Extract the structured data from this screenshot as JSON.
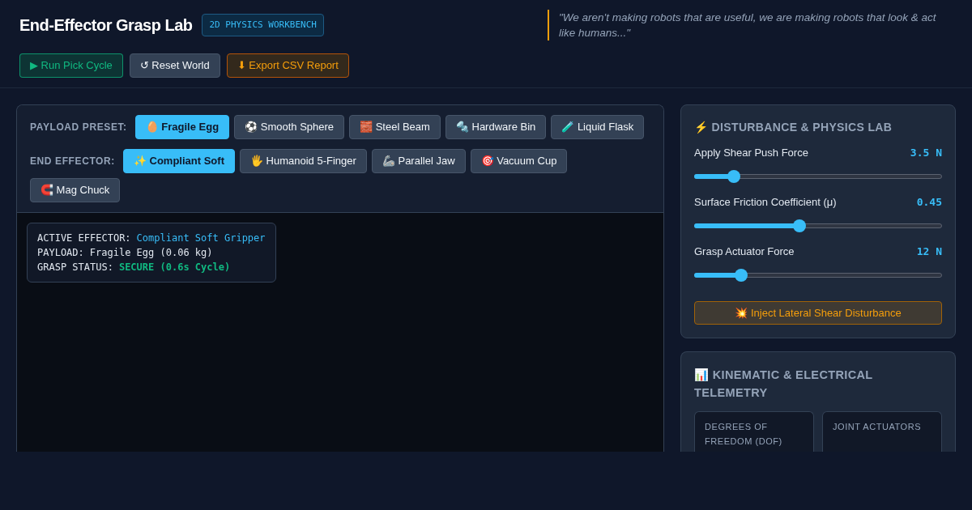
{
  "header": {
    "title": "End-Effector Grasp Lab",
    "badge": "2D PHYSICS WORKBENCH",
    "quote": "\"We aren't making robots that are useful, we are making robots that look & act like humans...\"",
    "actions": [
      {
        "label": "▶ Run Pick Cycle",
        "kind": "success"
      },
      {
        "label": "↺ Reset World",
        "kind": "neutral"
      },
      {
        "label": "⬇ Export CSV Report",
        "kind": "warning"
      }
    ]
  },
  "controls": [
    {
      "label": "PAYLOAD PRESET:",
      "options": [
        {
          "label": "🥚 Fragile Egg",
          "selected": true
        },
        {
          "label": "⚽ Smooth Sphere",
          "selected": false
        },
        {
          "label": "🧱 Steel Beam",
          "selected": false
        },
        {
          "label": "🔩 Hardware Bin",
          "selected": false
        },
        {
          "label": "🧪 Liquid Flask",
          "selected": false
        }
      ]
    },
    {
      "label": "END EFFECTOR:",
      "options": [
        {
          "label": "✨ Compliant Soft",
          "selected": true
        },
        {
          "label": "🖐️ Humanoid 5-Finger",
          "selected": false
        },
        {
          "label": "🦾 Parallel Jaw",
          "selected": false
        },
        {
          "label": "🎯 Vacuum Cup",
          "selected": false
        },
        {
          "label": "🧲 Mag Chuck",
          "selected": false
        }
      ]
    }
  ],
  "readout": [
    {
      "label": "ACTIVE EFFECTOR:",
      "value": "Compliant Soft Gripper",
      "kind": "info"
    },
    {
      "label": "PAYLOAD:",
      "value": "Fragile Egg (0.06 kg)",
      "kind": "plain"
    },
    {
      "label": "GRASP STATUS:",
      "value": "SECURE (0.6s Cycle)",
      "kind": "success"
    }
  ],
  "physics_panel": {
    "title": "⚡ DISTURBANCE & PHYSICS LAB",
    "sliders": [
      {
        "label": "Apply Shear Push Force",
        "reading": "3.5 N",
        "level": 0.16
      },
      {
        "label": "Surface Friction Coefficient (μ)",
        "reading": "0.45",
        "level": 0.425
      },
      {
        "label": "Grasp Actuator Force",
        "reading": "12 N",
        "level": 0.19
      }
    ],
    "button": "💥 Inject Lateral Shear Disturbance"
  },
  "telemetry_panel": {
    "title": "📊 KINEMATIC & ELECTRICAL TELEMETRY",
    "cards": [
      {
        "label": "DEGREES OF FREEDOM (DOF)"
      },
      {
        "label": "JOINT ACTUATORS"
      }
    ]
  }
}
